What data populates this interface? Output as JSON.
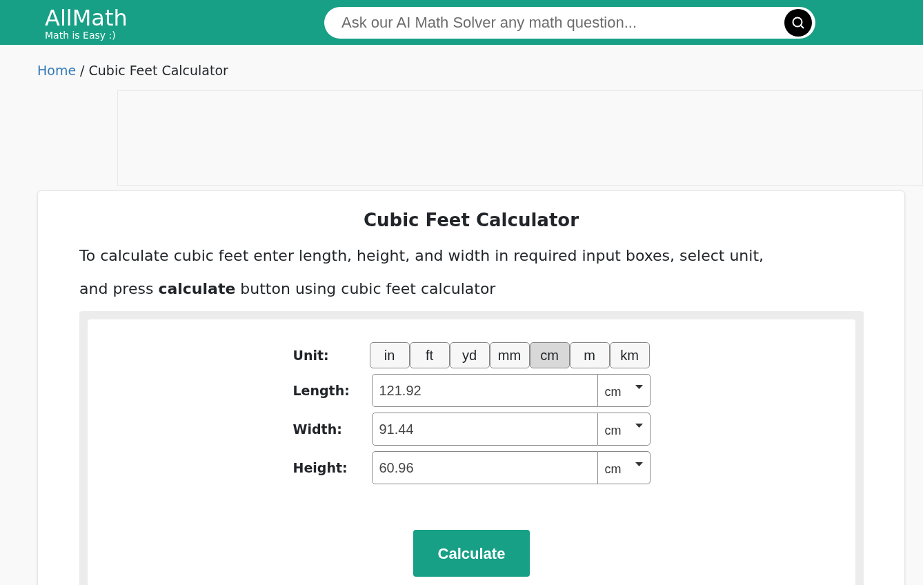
{
  "header": {
    "logo": "AllMath",
    "tagline": "Math is Easy :)",
    "search": {
      "placeholder": "Ask our AI Math Solver any math question..."
    }
  },
  "breadcrumb": {
    "home": "Home",
    "separator": "/",
    "current": "Cubic Feet Calculator"
  },
  "calculator": {
    "title": "Cubic Feet Calculator",
    "description": [
      "To calculate cubic feet enter length, height, and width in required input boxes, select unit,",
      "and press **calculate** button using cubic feet calculator"
    ],
    "unit_label": "Unit:",
    "units": [
      {
        "label": "in",
        "selected": false
      },
      {
        "label": "ft",
        "selected": false
      },
      {
        "label": "yd",
        "selected": false
      },
      {
        "label": "mm",
        "selected": false
      },
      {
        "label": "cm",
        "selected": true
      },
      {
        "label": "m",
        "selected": false
      },
      {
        "label": "km",
        "selected": false
      }
    ],
    "fields": [
      {
        "label": "Length:",
        "value": "121.92",
        "unit": "cm"
      },
      {
        "label": "Width:",
        "value": "91.44",
        "unit": "cm"
      },
      {
        "label": "Height:",
        "value": "60.96",
        "unit": "cm"
      }
    ],
    "button": "Calculate"
  }
}
